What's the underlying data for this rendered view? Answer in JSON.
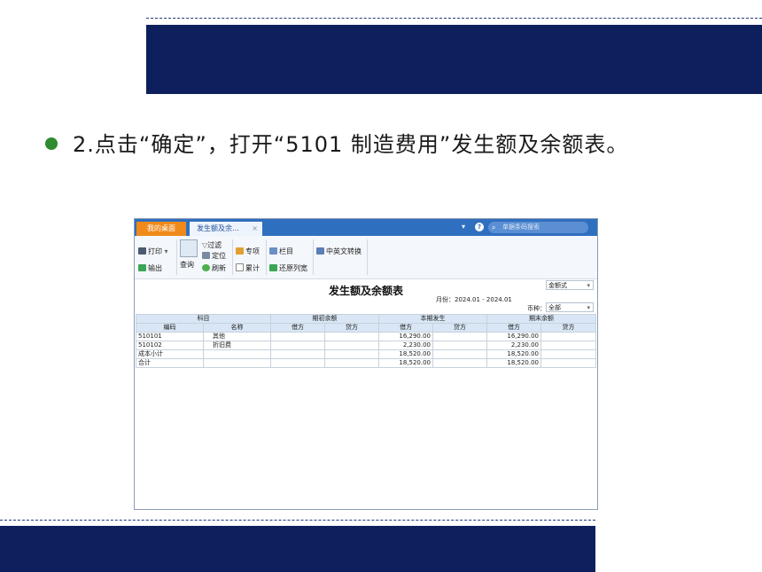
{
  "slide": {
    "step_text": "2.点击“确定”，打开“5101 制造费用”发生额及余额表。"
  },
  "app": {
    "tabs": {
      "home": "我的桌面",
      "active": "发生额及余…",
      "close": "×"
    },
    "titlebar": {
      "chevron": "▾",
      "help": "?",
      "search_placeholder": "单据条码搜索"
    },
    "toolbar": {
      "print": "打印",
      "print_arrow": "▾",
      "export": "输出",
      "query": "查询",
      "filter": "过滤",
      "locate": "定位",
      "refresh": "刷新",
      "special": "专项",
      "cumulative": "累计",
      "columns": "栏目",
      "restore_cols": "还原列宽",
      "cn_en": "中英文转换"
    },
    "report": {
      "title": "发生额及余额表",
      "format_select": "金额式",
      "month_label": "月份：2024.01 - 2024.01",
      "currency_label": "币种：",
      "currency_value": "全部"
    },
    "table": {
      "groups": [
        "科目",
        "期初余额",
        "本期发生",
        "期末余额"
      ],
      "columns": [
        "编码",
        "名称",
        "借方",
        "贷方",
        "借方",
        "贷方",
        "借方",
        "贷方"
      ],
      "rows": [
        [
          "510101",
          "其他",
          "",
          "",
          "16,290.00",
          "",
          "16,290.00",
          ""
        ],
        [
          "510102",
          "折旧费",
          "",
          "",
          "2,230.00",
          "",
          "2,230.00",
          ""
        ],
        [
          "成本小计",
          "",
          "",
          "",
          "18,520.00",
          "",
          "18,520.00",
          ""
        ],
        [
          "合计",
          "",
          "",
          "",
          "18,520.00",
          "",
          "18,520.00",
          ""
        ]
      ]
    }
  },
  "colors": {
    "band": "#0d1f5c",
    "bullet": "#2e8b2e",
    "titlebar": "#2f6fc0",
    "home_tab": "#f08a1a"
  }
}
